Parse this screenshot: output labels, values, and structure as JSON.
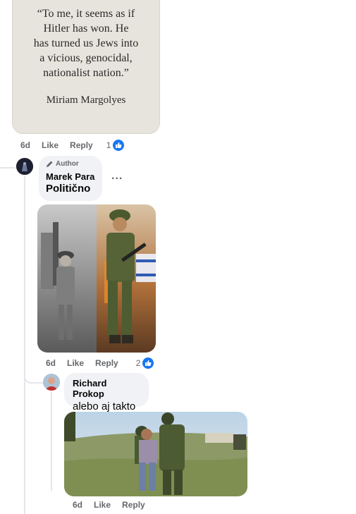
{
  "quote_post": {
    "lines": [
      "“To me, it seems as  if",
      "Hitler has won. He",
      "has turned us Jews into",
      "a vicious, genocidal,",
      "nationalist nation.”"
    ],
    "author": "Miriam Margolyes",
    "time": "6d",
    "like_label": "Like",
    "reply_label": "Reply",
    "reactions": "1"
  },
  "comment_author": {
    "badge": "Author",
    "name": "Marek Para",
    "text": "Politično",
    "more_label": "...",
    "time": "6d",
    "like_label": "Like",
    "reply_label": "Reply",
    "reactions": "2"
  },
  "reply": {
    "name": "Richard Prokop",
    "text": "alebo aj takto",
    "time": "6d",
    "like_label": "Like",
    "reply_label": "Reply"
  },
  "colors": {
    "like_blue": "#1877f2",
    "bubble_bg": "#f0f2f5",
    "meta_gray": "#65676b"
  },
  "icons": {
    "author": "pencil-icon",
    "reaction": "thumbs-up-icon"
  }
}
